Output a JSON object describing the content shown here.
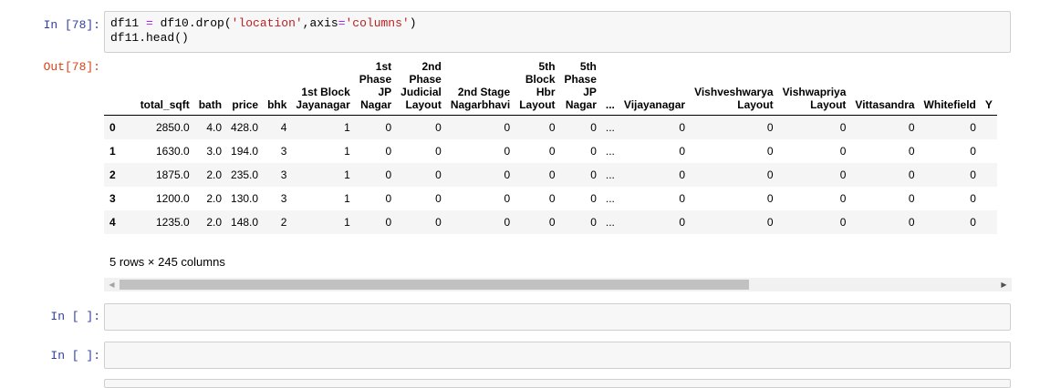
{
  "cell1": {
    "in_prompt": "In [78]:",
    "out_prompt": "Out[78]:",
    "code_line1_parts": [
      "df11 ",
      "=",
      " df10.drop(",
      "'location'",
      ",axis",
      "=",
      "'columns'",
      ")"
    ],
    "code_line2": "df11.head()"
  },
  "table": {
    "columns": [
      "total_sqft",
      "bath",
      "price",
      "bhk",
      "1st Block\nJayanagar",
      "1st\nPhase\nJP\nNagar",
      "2nd\nPhase\nJudicial\nLayout",
      "2nd Stage\nNagarbhavi",
      "5th\nBlock\nHbr\nLayout",
      "5th\nPhase\nJP\nNagar",
      "...",
      "Vijayanagar",
      "Vishveshwarya\nLayout",
      "Vishwapriya\nLayout",
      "Vittasandra",
      "Whitefield",
      "Y"
    ],
    "rows": [
      {
        "index": "0",
        "cells": [
          "2850.0",
          "4.0",
          "428.0",
          "4",
          "1",
          "0",
          "0",
          "0",
          "0",
          "0",
          "...",
          "0",
          "0",
          "0",
          "0",
          "0",
          ""
        ]
      },
      {
        "index": "1",
        "cells": [
          "1630.0",
          "3.0",
          "194.0",
          "3",
          "1",
          "0",
          "0",
          "0",
          "0",
          "0",
          "...",
          "0",
          "0",
          "0",
          "0",
          "0",
          ""
        ]
      },
      {
        "index": "2",
        "cells": [
          "1875.0",
          "2.0",
          "235.0",
          "3",
          "1",
          "0",
          "0",
          "0",
          "0",
          "0",
          "...",
          "0",
          "0",
          "0",
          "0",
          "0",
          ""
        ]
      },
      {
        "index": "3",
        "cells": [
          "1200.0",
          "2.0",
          "130.0",
          "3",
          "1",
          "0",
          "0",
          "0",
          "0",
          "0",
          "...",
          "0",
          "0",
          "0",
          "0",
          "0",
          ""
        ]
      },
      {
        "index": "4",
        "cells": [
          "1235.0",
          "2.0",
          "148.0",
          "2",
          "1",
          "0",
          "0",
          "0",
          "0",
          "0",
          "...",
          "0",
          "0",
          "0",
          "0",
          "0",
          ""
        ]
      }
    ],
    "shape_text": "5 rows × 245 columns"
  },
  "scrollbar": {
    "left_arrow": "◀",
    "right_arrow": "▶"
  },
  "empty_cells": [
    {
      "in_prompt": "In [ ]:"
    },
    {
      "in_prompt": "In [ ]:"
    }
  ]
}
